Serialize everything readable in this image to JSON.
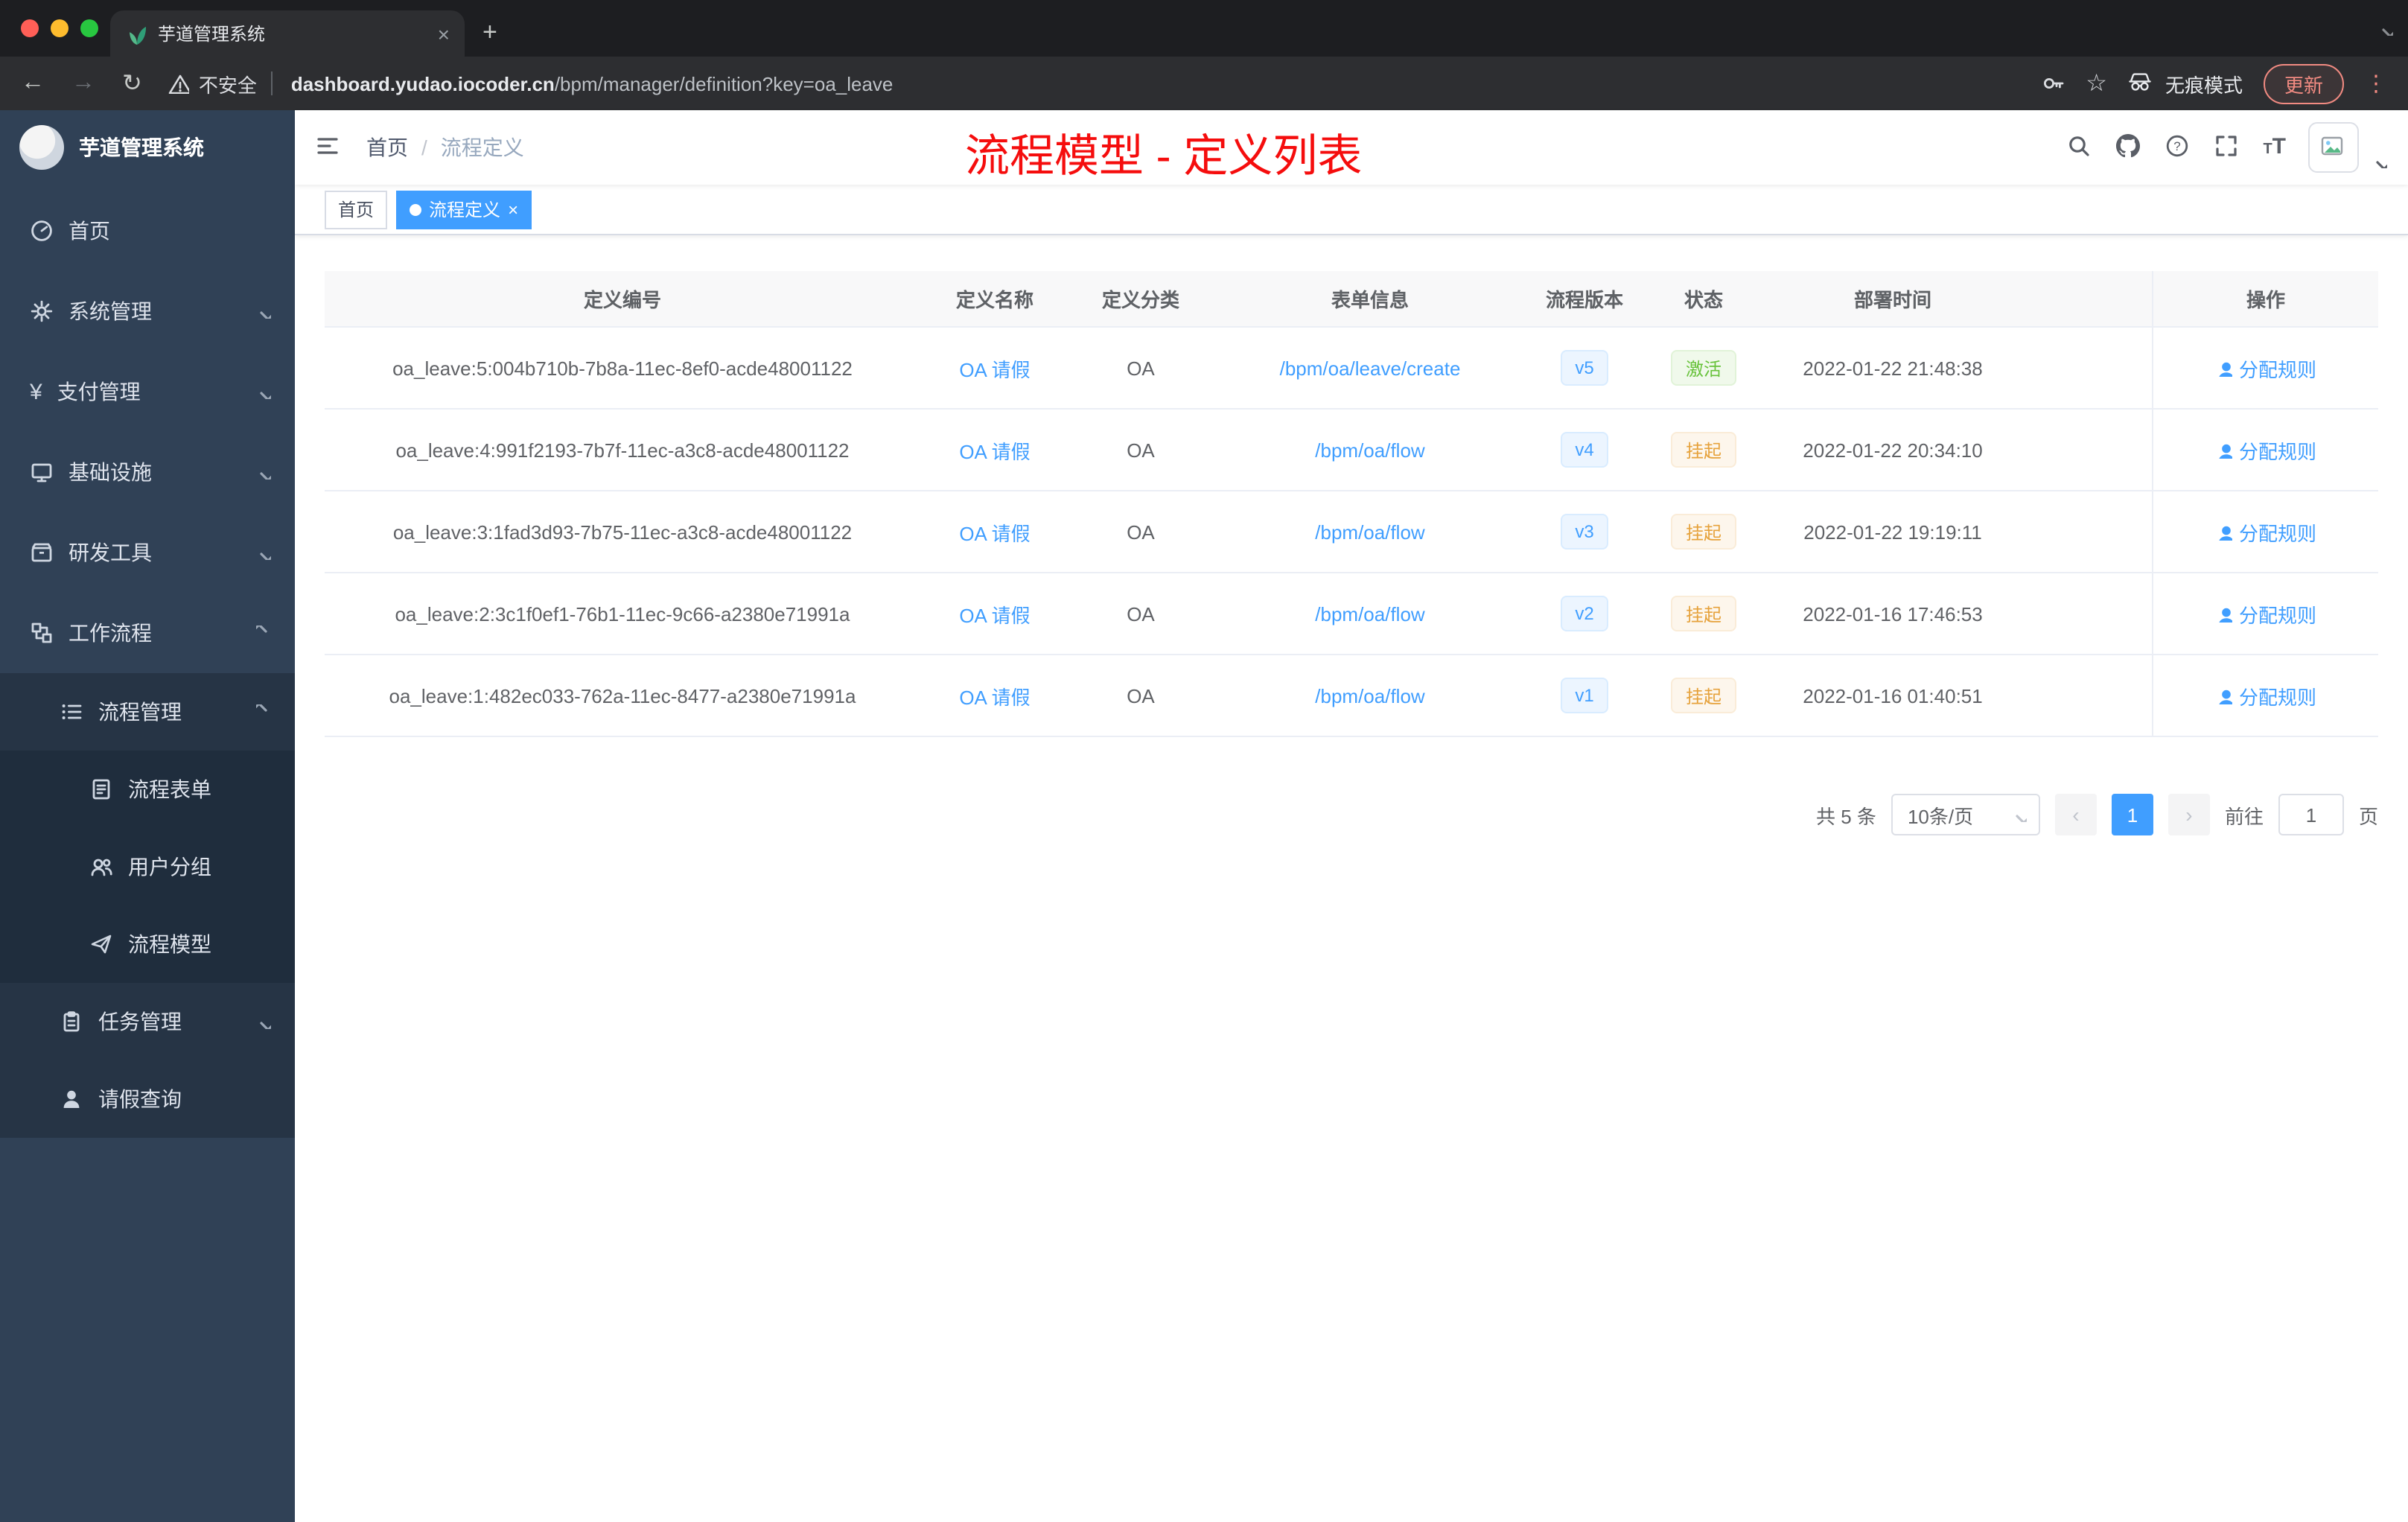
{
  "browser": {
    "tab_title": "芋道管理系统",
    "tab_close": "×",
    "new_tab": "+",
    "back": "←",
    "forward": "→",
    "reload": "↻",
    "security_label": "不安全",
    "url_host": "dashboard.yudao.iocoder.cn",
    "url_path": "/bpm/manager/definition?key=oa_leave",
    "incognito_label": "无痕模式",
    "update_label": "更新",
    "menu_dots": "⋮",
    "star": "☆"
  },
  "sidebar": {
    "title": "芋道管理系统",
    "items": [
      {
        "label": "首页"
      },
      {
        "label": "系统管理"
      },
      {
        "label": "支付管理"
      },
      {
        "label": "基础设施"
      },
      {
        "label": "研发工具"
      },
      {
        "label": "工作流程"
      },
      {
        "label": "流程管理"
      },
      {
        "label": "流程表单"
      },
      {
        "label": "用户分组"
      },
      {
        "label": "流程模型"
      },
      {
        "label": "任务管理"
      },
      {
        "label": "请假查询"
      }
    ]
  },
  "header": {
    "breadcrumb": [
      "首页",
      "流程定义"
    ],
    "breadcrumb_separator": "/",
    "overlay_title": "流程模型 - 定义列表"
  },
  "tags": [
    {
      "label": "首页"
    },
    {
      "label": "流程定义",
      "close": "×"
    }
  ],
  "table": {
    "columns": [
      "定义编号",
      "定义名称",
      "定义分类",
      "表单信息",
      "流程版本",
      "状态",
      "部署时间",
      "操作"
    ],
    "rows": [
      {
        "id": "oa_leave:5:004b710b-7b8a-11ec-8ef0-acde48001122",
        "name": "OA 请假",
        "category": "OA",
        "form": "/bpm/oa/leave/create",
        "version": "v5",
        "status": "激活",
        "time": "2022-01-22 21:48:38",
        "action": "分配规则"
      },
      {
        "id": "oa_leave:4:991f2193-7b7f-11ec-a3c8-acde48001122",
        "name": "OA 请假",
        "category": "OA",
        "form": "/bpm/oa/flow",
        "version": "v4",
        "status": "挂起",
        "time": "2022-01-22 20:34:10",
        "action": "分配规则"
      },
      {
        "id": "oa_leave:3:1fad3d93-7b75-11ec-a3c8-acde48001122",
        "name": "OA 请假",
        "category": "OA",
        "form": "/bpm/oa/flow",
        "version": "v3",
        "status": "挂起",
        "time": "2022-01-22 19:19:11",
        "action": "分配规则"
      },
      {
        "id": "oa_leave:2:3c1f0ef1-76b1-11ec-9c66-a2380e71991a",
        "name": "OA 请假",
        "category": "OA",
        "form": "/bpm/oa/flow",
        "version": "v2",
        "status": "挂起",
        "time": "2022-01-16 17:46:53",
        "action": "分配规则"
      },
      {
        "id": "oa_leave:1:482ec033-762a-11ec-8477-a2380e71991a",
        "name": "OA 请假",
        "category": "OA",
        "form": "/bpm/oa/flow",
        "version": "v1",
        "status": "挂起",
        "time": "2022-01-16 01:40:51",
        "action": "分配规则"
      }
    ]
  },
  "pagination": {
    "total": "共 5 条",
    "page_size": "10条/页",
    "prev": "‹",
    "page": "1",
    "next": "›",
    "goto_label": "前往",
    "goto_value": "1",
    "unit": "页"
  },
  "colors": {
    "accent": "#409eff",
    "annotation_red": "#f50d0d",
    "status_active_green": "#67c23a",
    "status_suspend_orange": "#e6a23c",
    "sidebar_bg": "#304156"
  }
}
